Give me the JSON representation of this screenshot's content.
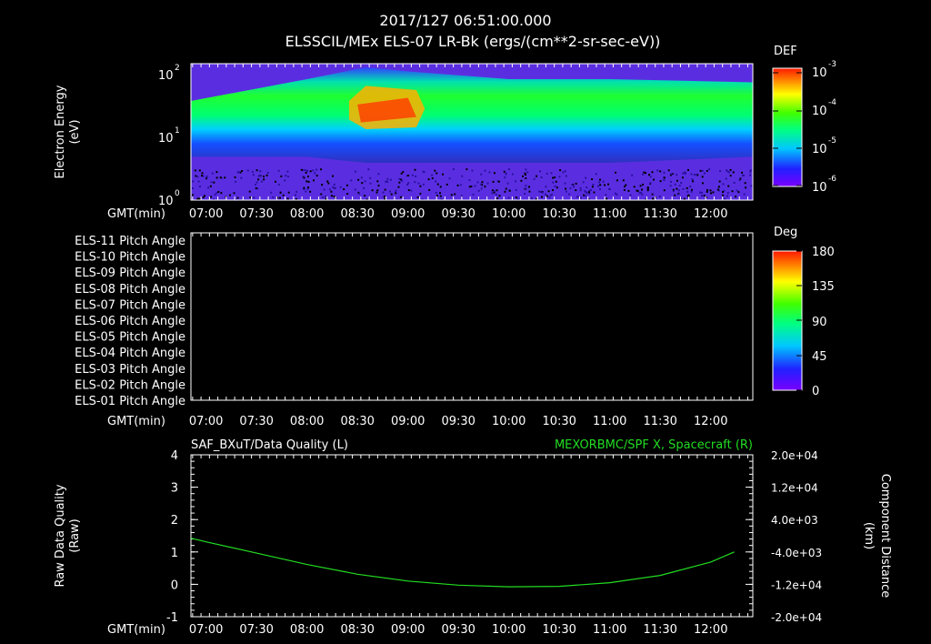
{
  "header": {
    "datetime": "2017/127 06:51:00.000",
    "title": "ELSSCIL/MEx ELS-07 LR-Bk  (ergs/(cm**2-sr-sec-eV))"
  },
  "time_axis": {
    "label": "GMT(min)",
    "ticks": [
      "07:00",
      "07:30",
      "08:00",
      "08:30",
      "09:00",
      "09:30",
      "10:00",
      "10:30",
      "11:00",
      "11:30",
      "12:00"
    ],
    "tick_minutes": [
      420,
      450,
      480,
      510,
      540,
      570,
      600,
      630,
      660,
      690,
      720
    ],
    "range_minutes": [
      411,
      745
    ]
  },
  "panel1": {
    "ylabel_line1": "Electron Energy",
    "ylabel_line2": "(eV)",
    "y_ticks": [
      "10",
      "10",
      "10"
    ],
    "y_tick_exps": [
      "0",
      "1",
      "2"
    ],
    "colorbar": {
      "title": "DEF",
      "labels": [
        "10",
        "10",
        "10",
        "10"
      ],
      "exps": [
        "-3",
        "-4",
        "-5",
        "-6"
      ]
    }
  },
  "panel2": {
    "channels": [
      "ELS-11 Pitch Angle",
      "ELS-10 Pitch Angle",
      "ELS-09 Pitch Angle",
      "ELS-08 Pitch Angle",
      "ELS-07 Pitch Angle",
      "ELS-06 Pitch Angle",
      "ELS-05 Pitch Angle",
      "ELS-04 Pitch Angle",
      "ELS-03 Pitch Angle",
      "ELS-02 Pitch Angle",
      "ELS-01 Pitch Angle"
    ],
    "colorbar": {
      "title": "Deg",
      "labels": [
        "180",
        "135",
        "90",
        "45",
        "0"
      ]
    }
  },
  "panel3": {
    "title_left": "SAF_BXuT/Data Quality (L)",
    "title_right": "MEXORBMC/SPF X, Spacecraft (R)",
    "ylabel_left_line1": "Raw Data Quality",
    "ylabel_left_line2": "(Raw)",
    "ylabel_right_line1": "Component Distance",
    "ylabel_right_line2": "(km)",
    "y_left_ticks": [
      "4",
      "3",
      "2",
      "1",
      "0",
      "-1"
    ],
    "y_right_ticks": [
      "2.0e+04",
      "1.2e+04",
      "4.0e+03",
      "-4.0e+03",
      "-1.2e+04",
      "-2.0e+04"
    ],
    "line_color": "#22dd22"
  },
  "chart_data": [
    {
      "type": "heatmap",
      "x_unit": "minutes of day",
      "y_scale": "log",
      "ylim": [
        1,
        160
      ],
      "energy_band_eV": [
        {
          "x": 420,
          "low": 5,
          "peak": 12,
          "high": 40
        },
        {
          "x": 480,
          "low": 5,
          "peak": 14,
          "high": 90
        },
        {
          "x": 515,
          "low": 4,
          "peak": 25,
          "high": 140
        },
        {
          "x": 540,
          "low": 4,
          "peak": 22,
          "high": 120
        },
        {
          "x": 600,
          "low": 4,
          "peak": 15,
          "high": 90
        },
        {
          "x": 660,
          "low": 4,
          "peak": 14,
          "high": 90
        },
        {
          "x": 720,
          "low": 5,
          "peak": 12,
          "high": 80
        }
      ],
      "colorbar_range": [
        "1e-6",
        "1e-3"
      ]
    },
    {
      "type": "heatmap",
      "note": "empty panel",
      "colorbar_range": [
        0,
        180
      ]
    },
    {
      "type": "line",
      "series": [
        {
          "name": "MEXORBMC/SPF X, Spacecraft (R)",
          "axis": "right",
          "x": [
            411,
            420,
            450,
            480,
            510,
            540,
            570,
            600,
            630,
            660,
            690,
            720,
            734
          ],
          "y": [
            -600,
            -1500,
            -4300,
            -7100,
            -9500,
            -11200,
            -12200,
            -12600,
            -12500,
            -11600,
            -9800,
            -6500,
            -4000
          ]
        }
      ],
      "ylim_left": [
        -1,
        4
      ],
      "ylim_right": [
        -20000,
        20000
      ]
    }
  ]
}
